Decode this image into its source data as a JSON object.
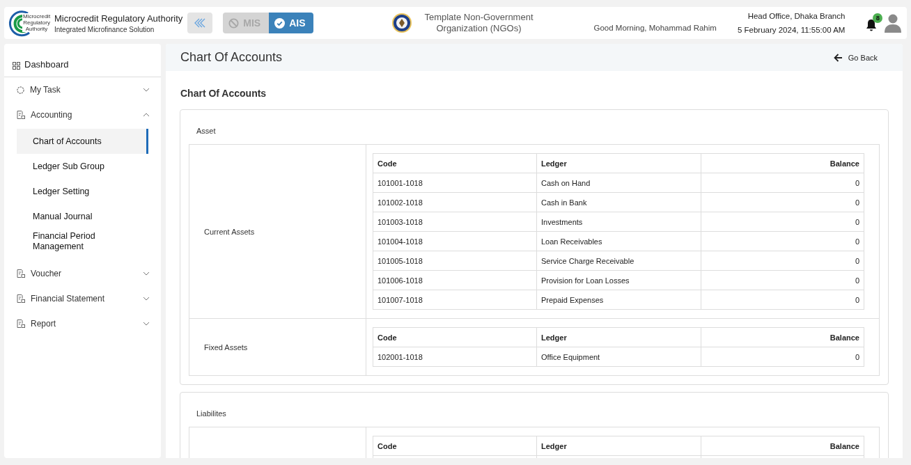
{
  "header": {
    "logo_lines": [
      "Microcredit",
      "Regulatory",
      "Authority"
    ],
    "org_name": "Microcredit Regulatory Authority",
    "org_subtitle": "Integrated Microfinance Solution",
    "modules": [
      {
        "label": "MIS",
        "selected": false
      },
      {
        "label": "AIS",
        "selected": true
      }
    ],
    "ngo_name": "Template Non-Government Organization (NGOs)",
    "greeting": "Good Morning, Mohammad Rahim",
    "branch": "Head Office, Dhaka Branch",
    "datetime": "5 February 2024, 11:55:00 AM",
    "notification_count": "8"
  },
  "sidebar": {
    "items": [
      {
        "label": "Dashboard",
        "kind": "top"
      },
      {
        "label": "My Task",
        "kind": "task",
        "expanded": false
      },
      {
        "label": "Accounting",
        "kind": "group",
        "expanded": true,
        "children": [
          {
            "label": "Chart of Accounts",
            "selected": true
          },
          {
            "label": "Ledger Sub Group",
            "selected": false
          },
          {
            "label": "Ledger Setting",
            "selected": false
          },
          {
            "label": "Manual Journal",
            "selected": false
          },
          {
            "label": "Financial Period Management",
            "selected": false
          }
        ]
      },
      {
        "label": "Voucher",
        "kind": "group",
        "expanded": false
      },
      {
        "label": "Financial Statement",
        "kind": "group",
        "expanded": false
      },
      {
        "label": "Report",
        "kind": "group",
        "expanded": false
      }
    ]
  },
  "page": {
    "title": "Chart Of Accounts",
    "go_back": "Go Back",
    "section_title": "Chart Of Accounts",
    "groups": [
      {
        "title": "Asset",
        "subgroups": [
          {
            "name": "Current Assets",
            "columns": [
              "Code",
              "Ledger",
              "Balance"
            ],
            "rows": [
              {
                "code": "101001-1018",
                "ledger": "Cash on Hand",
                "balance": "0"
              },
              {
                "code": "101002-1018",
                "ledger": "Cash in Bank",
                "balance": "0"
              },
              {
                "code": "101003-1018",
                "ledger": "Investments",
                "balance": "0"
              },
              {
                "code": "101004-1018",
                "ledger": "Loan Receivables",
                "balance": "0"
              },
              {
                "code": "101005-1018",
                "ledger": "Service Charge Receivable",
                "balance": "0"
              },
              {
                "code": "101006-1018",
                "ledger": "Provision for Loan Losses",
                "balance": "0"
              },
              {
                "code": "101007-1018",
                "ledger": "Prepaid Expenses",
                "balance": "0"
              }
            ]
          },
          {
            "name": "Fixed Assets",
            "columns": [
              "Code",
              "Ledger",
              "Balance"
            ],
            "rows": [
              {
                "code": "102001-1018",
                "ledger": "Office Equipment",
                "balance": "0"
              }
            ]
          }
        ]
      },
      {
        "title": "Liabilites",
        "subgroups": [
          {
            "columns": [
              "Code",
              "Ledger",
              "Balance"
            ]
          }
        ]
      }
    ]
  }
}
